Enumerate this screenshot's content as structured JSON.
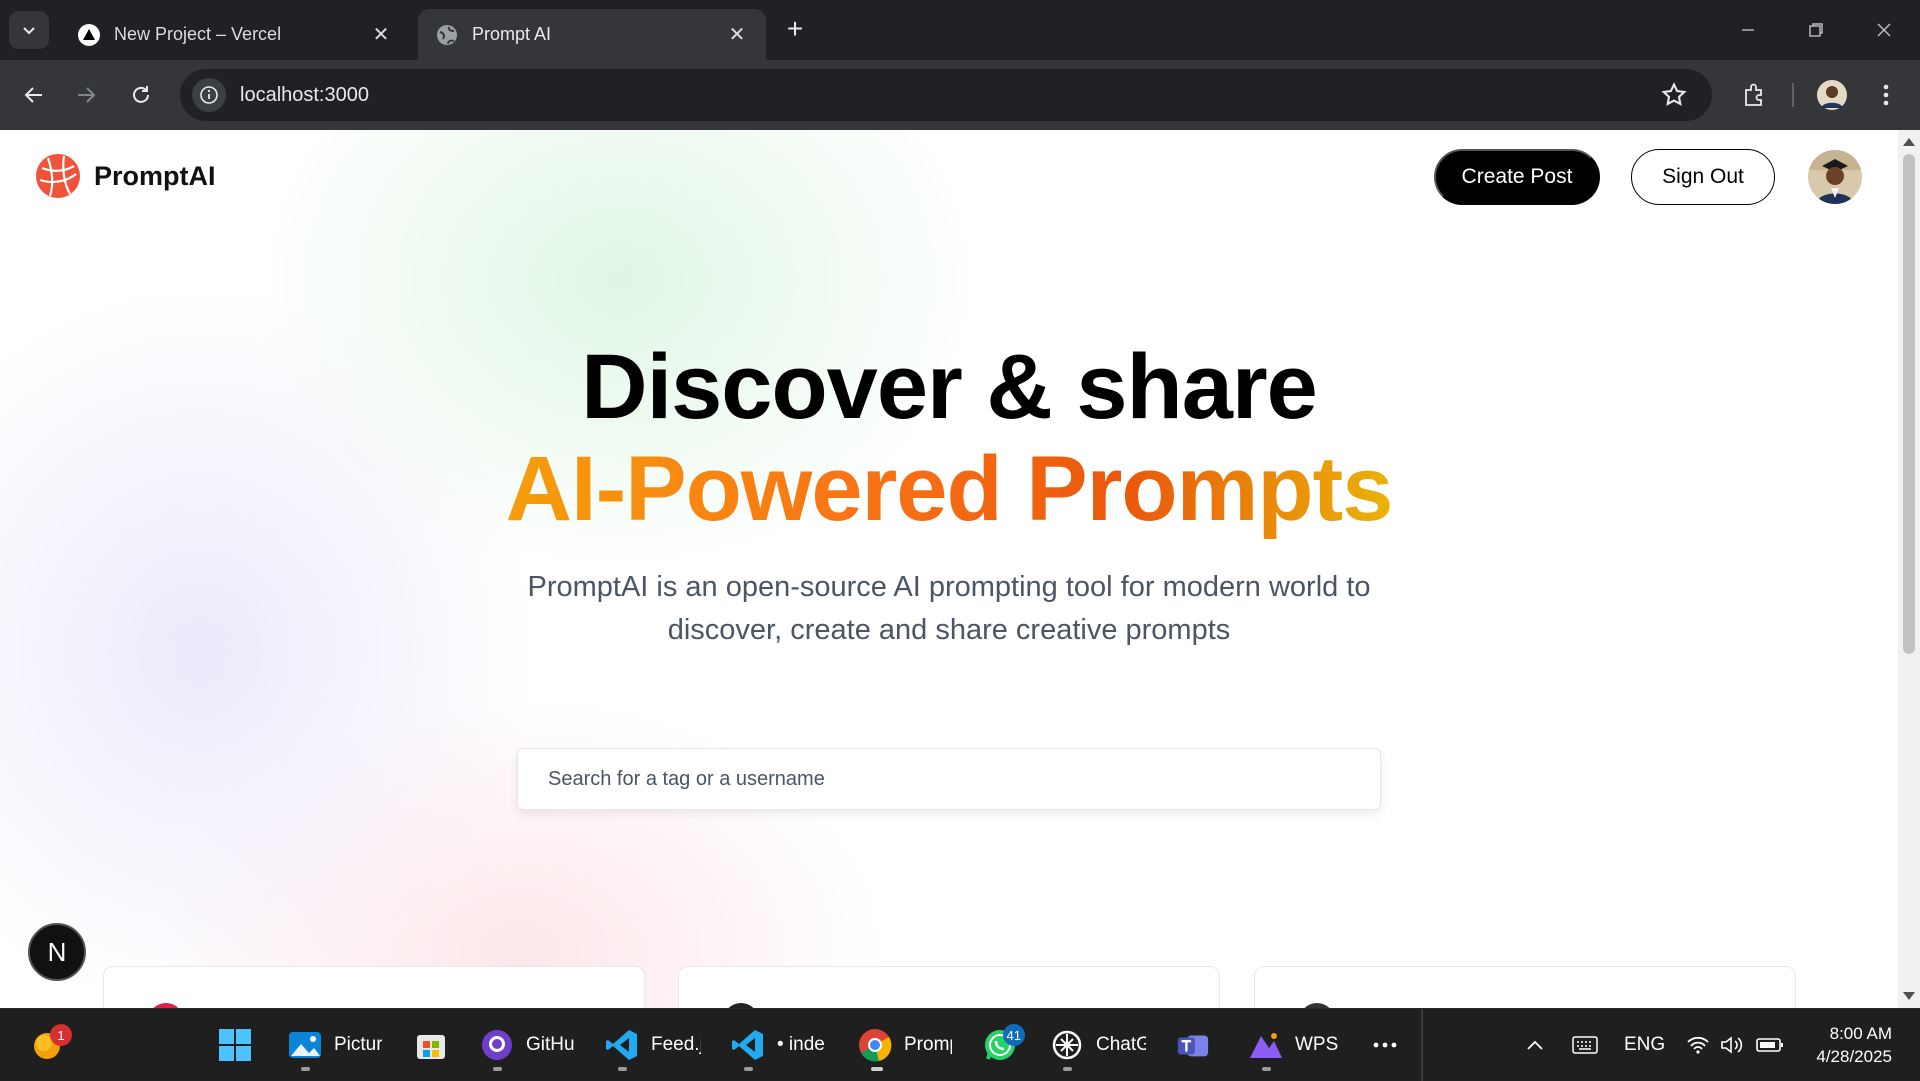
{
  "browser": {
    "tabs": [
      {
        "title": "New Project – Vercel",
        "active": false
      },
      {
        "title": "Prompt AI",
        "active": true
      }
    ],
    "address": "localhost:3000"
  },
  "page": {
    "brand": "PromptAI",
    "nav": {
      "create_post": "Create Post",
      "sign_out": "Sign Out"
    },
    "hero": {
      "line1": "Discover & share",
      "line2": "AI-Powered Prompts",
      "description": "PromptAI is an open-source AI prompting tool for modern world to discover, create and share creative prompts"
    },
    "search": {
      "placeholder": "Search for a tag or a username",
      "value": ""
    },
    "dev_badge": "N",
    "colors": {
      "gradient_start": "#f59e0b",
      "gradient_mid": "#ea580c",
      "gradient_end": "#eab308"
    }
  },
  "taskbar": {
    "apps": [
      {
        "label": "Pictur",
        "icon": "photos-icon"
      },
      {
        "label": "",
        "icon": "store-icon"
      },
      {
        "label": "GitHu",
        "icon": "github-icon"
      },
      {
        "label": "Feed.j",
        "icon": "vscode-icon"
      },
      {
        "label": "• inde",
        "icon": "vscode-icon"
      },
      {
        "label": "Promp",
        "icon": "chrome-icon"
      },
      {
        "label": "",
        "icon": "whatsapp-icon",
        "badge": "41"
      },
      {
        "label": "ChatG",
        "icon": "chatgpt-icon"
      },
      {
        "label": "",
        "icon": "teams-icon"
      },
      {
        "label": "WPS",
        "icon": "wps-icon"
      }
    ],
    "notification_badge": "1",
    "lang": "ENG",
    "time": "8:00 AM",
    "date": "4/28/2025"
  }
}
